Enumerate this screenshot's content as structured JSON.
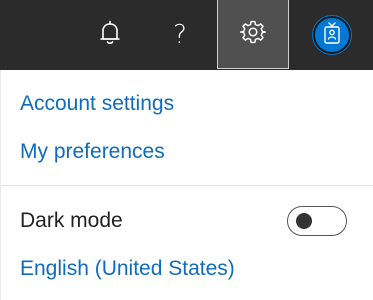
{
  "topbar": {
    "icons": {
      "notifications": "bell-icon",
      "help": "question-mark-icon",
      "settings": "gear-icon",
      "account": "contact-card-icon"
    },
    "help_glyph": "?",
    "settings_active": true,
    "avatar_color": "#0078d4"
  },
  "menu": {
    "account_settings": "Account settings",
    "my_preferences": "My preferences",
    "dark_mode_label": "Dark mode",
    "dark_mode_on": false,
    "language": "English (United States)"
  },
  "colors": {
    "topbar_bg": "#2b2b2b",
    "active_button_bg": "#505050",
    "link": "#0f6cbd"
  }
}
